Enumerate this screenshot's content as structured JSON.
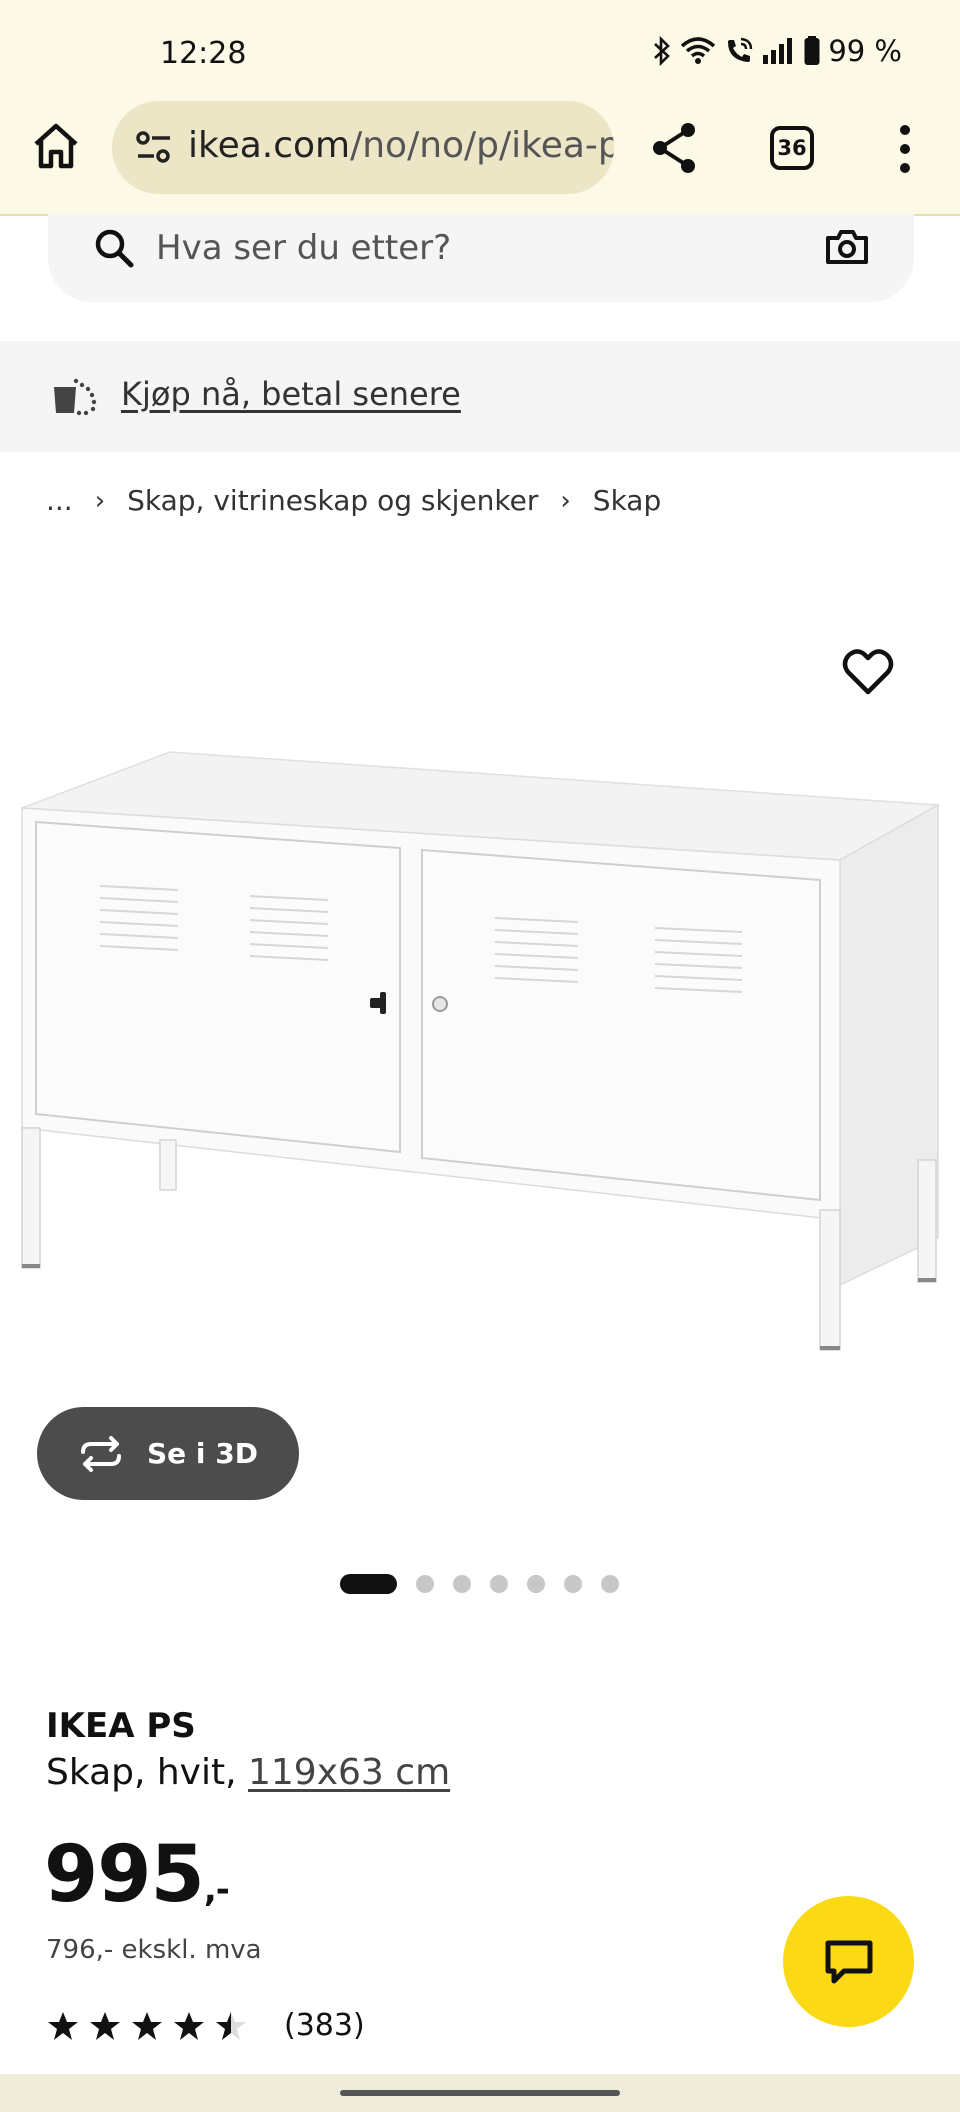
{
  "status_bar": {
    "time": "12:28",
    "battery": "99 %"
  },
  "browser": {
    "url_host": "ikea.com",
    "url_path": "/no/no/p/ikea-p",
    "tab_count": "36"
  },
  "search": {
    "placeholder": "Hva ser du etter?"
  },
  "banner": {
    "link": "Kjøp nå, betal senere"
  },
  "breadcrumb": {
    "items": [
      "...",
      "Skap, vitrineskap og skjenker",
      "Skap"
    ]
  },
  "gallery": {
    "view_3d_label": "Se i 3D",
    "dot_count": 7,
    "active_index": 0
  },
  "product": {
    "name": "IKEA PS",
    "description": "Skap, hvit,",
    "size_link": "119x63 cm",
    "price": "995",
    "price_suffix": ",-",
    "price_ex_vat": "796,- ekskl. mva",
    "rating": 4.5,
    "review_count": "(383)"
  },
  "colors": {
    "chrome_bg": "#fcf9e6",
    "url_pill": "#ece6c7",
    "chat_yellow": "#fbd914",
    "btn_3d": "#4c4c4c"
  }
}
